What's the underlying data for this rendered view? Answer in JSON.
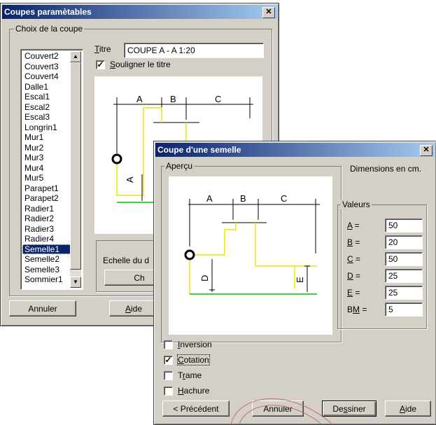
{
  "back_window": {
    "title": "Coupes paramètables",
    "group_label": "Choix de la coupe",
    "list_items": [
      "Couvert2",
      "Couvert3",
      "Couvert4",
      "Dalle1",
      "Escal1",
      "Escal2",
      "Escal3",
      "Longrin1",
      "Mur1",
      "Mur2",
      "Mur3",
      "Mur4",
      "Mur5",
      "Parapet1",
      "Parapet2",
      "Radier1",
      "Radier2",
      "Radier3",
      "Radier4",
      "Semelle1",
      "Semelle2",
      "Semelle3",
      "Sommier1"
    ],
    "selected_item": "Semelle1",
    "titre_label_accel": "T",
    "titre_label_rest": "itre",
    "titre_value": "COUPE A - A 1:20",
    "souligner_accel": "S",
    "souligner_rest": "ouligner le titre",
    "souligner_checked": "✓",
    "preview_labels": [
      "A",
      "B",
      "C"
    ],
    "preview_side_label": "A",
    "echelle_label": "Echelle du d",
    "ch_button": "Ch",
    "annuler_button": "Annuler",
    "aide_button_accel": "A",
    "aide_button_rest": "ide"
  },
  "front_window": {
    "title": "Coupe d'une semelle",
    "apercu_label": "Aperçu",
    "dimensions_label": "Dimensions en cm.",
    "valeurs_label": "Valeurs",
    "preview_labels": [
      "A",
      "B",
      "C"
    ],
    "preview_side_labels": [
      "D",
      "E"
    ],
    "fields": [
      {
        "accel": "A",
        "rest": " =",
        "value": "50"
      },
      {
        "accel": "B",
        "rest": " =",
        "value": "20"
      },
      {
        "accel": "C",
        "rest": " =",
        "value": "50"
      },
      {
        "accel": "D",
        "rest": " =",
        "value": "25"
      },
      {
        "accel": "E",
        "rest": " =",
        "value": "25"
      },
      {
        "accel": "M",
        "pre": "B",
        "rest": " =",
        "value": "5"
      }
    ],
    "options": [
      {
        "accel": "I",
        "rest": "nversion",
        "checked": ""
      },
      {
        "accel": "C",
        "rest": "otation",
        "checked": "✓"
      },
      {
        "accel": "r",
        "pre": "T",
        "rest": "ame",
        "checked": ""
      },
      {
        "accel": "H",
        "rest": "achure",
        "checked": ""
      }
    ],
    "buttons": {
      "precedent": "< Précédent",
      "annuler": "Annuler",
      "dessiner_pre": "De",
      "dessiner_accel": "s",
      "dessiner_rest": "siner",
      "aide_accel": "A",
      "aide_rest": "ide"
    }
  },
  "colors": {
    "title_start": "#0a246a",
    "title_end": "#a6caf0",
    "face": "#d4d0c8",
    "selection": "#0a246a",
    "drawing_yellow": "#e8e800",
    "drawing_green": "#00c000"
  }
}
